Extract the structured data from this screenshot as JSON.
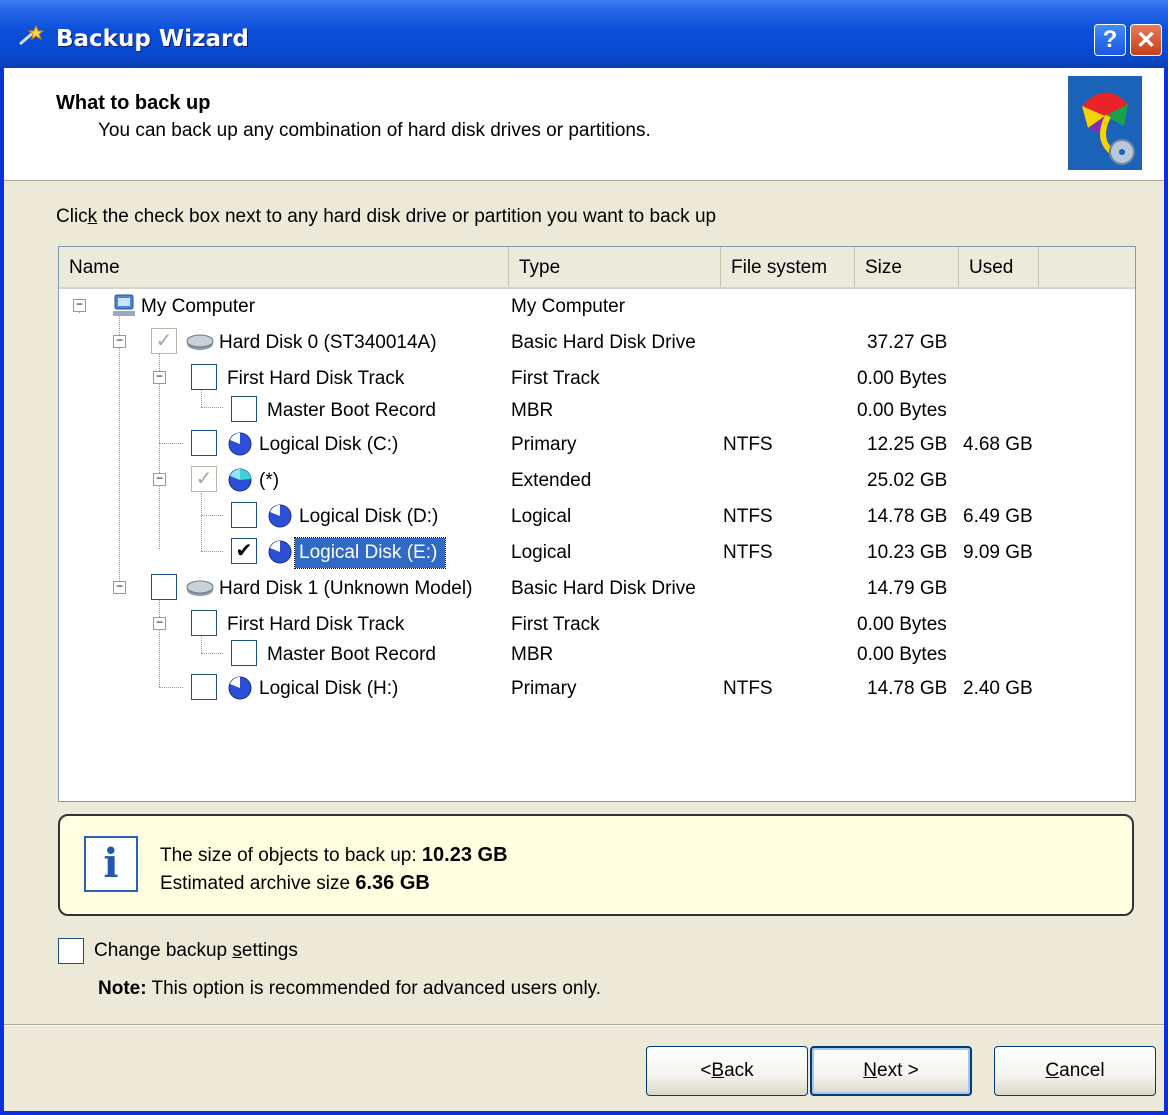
{
  "window": {
    "title": "Backup Wizard",
    "help_glyph": "?",
    "close_glyph": "✕"
  },
  "header": {
    "title": "What to back up",
    "subtitle": "You can back up any combination of hard disk drives or partitions."
  },
  "instruction": {
    "before": "Clic",
    "mnemonic": "k",
    "after": " the check box next to any hard disk drive or partition you want to back up"
  },
  "columns": [
    "Name",
    "Type",
    "File system",
    "Size",
    "Used"
  ],
  "rows": [
    {
      "name": "My Computer",
      "type": "My Computer",
      "fs": "",
      "size": "",
      "used": "",
      "check": ""
    },
    {
      "name": "Hard Disk 0 (ST340014A)",
      "type": "Basic Hard Disk Drive",
      "fs": "",
      "size": "37.27 GB",
      "used": "",
      "check": "✓"
    },
    {
      "name": "First Hard Disk Track",
      "type": "First Track",
      "fs": "",
      "size": "0.00 Bytes",
      "used": "",
      "check": ""
    },
    {
      "name": "Master Boot Record",
      "type": "MBR",
      "fs": "",
      "size": "0.00 Bytes",
      "used": "",
      "check": ""
    },
    {
      "name": "Logical Disk (C:)",
      "type": "Primary",
      "fs": "NTFS",
      "size": "12.25 GB",
      "used": "4.68 GB",
      "check": ""
    },
    {
      "name": "(*)",
      "type": "Extended",
      "fs": "",
      "size": "25.02 GB",
      "used": "",
      "check": "✓"
    },
    {
      "name": "Logical Disk (D:)",
      "type": "Logical",
      "fs": "NTFS",
      "size": "14.78 GB",
      "used": "6.49 GB",
      "check": ""
    },
    {
      "name": "Logical Disk (E:)",
      "type": "Logical",
      "fs": "NTFS",
      "size": "10.23 GB",
      "used": "9.09 GB",
      "check": "✔"
    },
    {
      "name": "Hard Disk 1 (Unknown Model)",
      "type": "Basic Hard Disk Drive",
      "fs": "",
      "size": "14.79 GB",
      "used": "",
      "check": ""
    },
    {
      "name": "First Hard Disk Track",
      "type": "First Track",
      "fs": "",
      "size": "0.00 Bytes",
      "used": "",
      "check": ""
    },
    {
      "name": "Master Boot Record",
      "type": "MBR",
      "fs": "",
      "size": "0.00 Bytes",
      "used": "",
      "check": ""
    },
    {
      "name": "Logical Disk (H:)",
      "type": "Primary",
      "fs": "NTFS",
      "size": "14.78 GB",
      "used": "2.40 GB",
      "check": ""
    }
  ],
  "info": {
    "size_label": "The size of objects to back up: ",
    "size_value": "10.23 GB",
    "archive_label": "Estimated archive size ",
    "archive_value": "6.36 GB",
    "icon_glyph": "i"
  },
  "settings": {
    "label_before": "Change backup ",
    "label_mnemonic": "s",
    "label_after": "ettings",
    "note_label": "Note:",
    "note_text": " This option is recommended for advanced users only."
  },
  "buttons": {
    "back_prefix": "< ",
    "back_mnemonic": "B",
    "back_rest": "ack",
    "next_mnemonic": "N",
    "next_rest": "ext >",
    "cancel_mnemonic": "C",
    "cancel_rest": "ancel"
  },
  "colors": {
    "titlebar": "#0b4fd9",
    "selection": "#316ac5",
    "info_background": "#ffffe1",
    "dialog_background": "#ece9d8"
  }
}
